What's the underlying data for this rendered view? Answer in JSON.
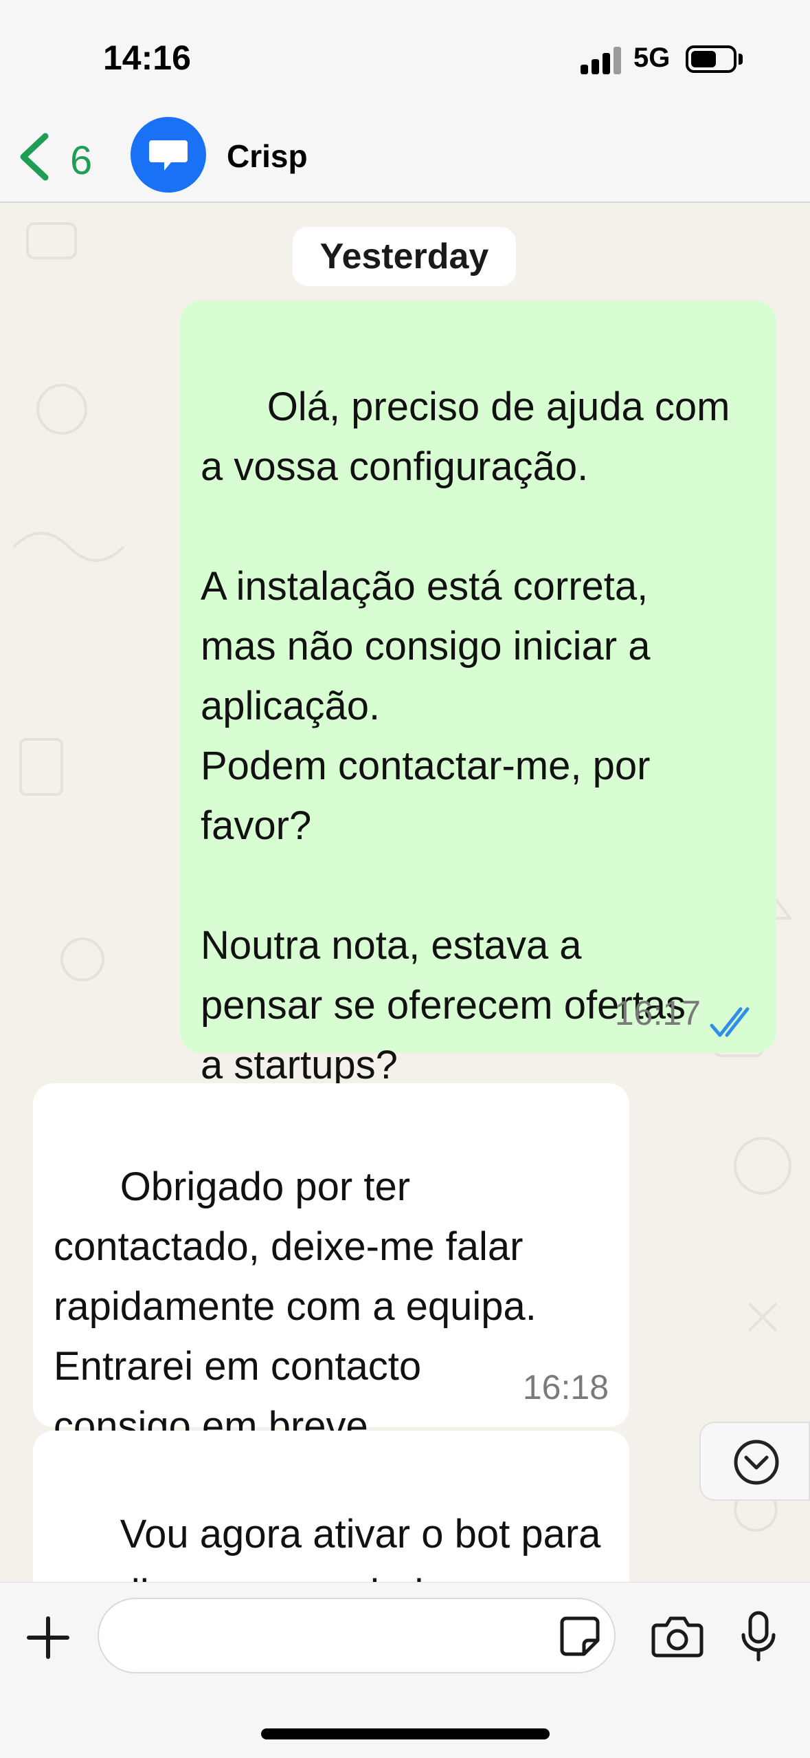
{
  "status_bar": {
    "time": "14:16",
    "network": "5G"
  },
  "header": {
    "back_count": "6",
    "contact_name": "Crisp",
    "accent_color": "#1f9d55",
    "avatar_color": "#1972f5"
  },
  "chat": {
    "date_label": "Yesterday",
    "messages": [
      {
        "direction": "outgoing",
        "text": "Olá, preciso de ajuda com\na vossa configuração.\n\nA instalação está correta,\nmas não consigo iniciar a\naplicação.\nPodem contactar-me, por\nfavor?\n\nNoutra nota, estava a\npensar se oferecem ofertas\na startups?",
        "time": "16:17",
        "status": "read"
      },
      {
        "direction": "incoming",
        "text": "Obrigado por ter\ncontactado, deixe-me falar\nrapidamente com a equipa.\nEntrarei em contacto\nconsigo em breve.",
        "time": "16:18"
      },
      {
        "direction": "incoming",
        "text": "Vou agora ativar o bot para\nrecolher os seus dados e\nenviar-lhe mais informações",
        "time": ""
      }
    ]
  },
  "composer": {
    "placeholder": ""
  },
  "icons": [
    "back-chevron-icon",
    "chat-bubble-icon",
    "double-check-icon",
    "chevron-down-icon",
    "plus-icon",
    "sticker-icon",
    "camera-icon",
    "microphone-icon"
  ]
}
